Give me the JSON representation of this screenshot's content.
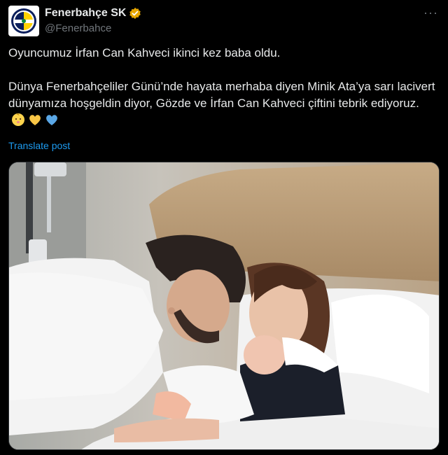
{
  "account": {
    "display_name": "Fenerbahçe SK",
    "handle": "@Fenerbahce",
    "verified_badge": "gold-verified-badge",
    "avatar_icon": "fenerbahce-crest-icon"
  },
  "menu": {
    "more_label": "···"
  },
  "post": {
    "line1": "Oyuncumuz İrfan Can Kahveci ikinci kez baba oldu.",
    "line2": "Dünya Fenerbahçeliler Günü’nde hayata merhaba diyen Minik Ata’ya sarı lacivert dünyamıza hoşgeldin diyor, Gözde ve İrfan Can Kahveci çiftini tebrik ediyoruz.",
    "emojis": [
      "baby-emoji",
      "yellow-heart-emoji",
      "blue-heart-emoji"
    ]
  },
  "translate_label": "Translate post",
  "media": {
    "image_icon": "hospital-family-photo"
  },
  "colors": {
    "link": "#1d9bf0",
    "muted": "#71767b",
    "text": "#e7e9ea",
    "badge": "#f4b400",
    "bg": "#000000"
  }
}
